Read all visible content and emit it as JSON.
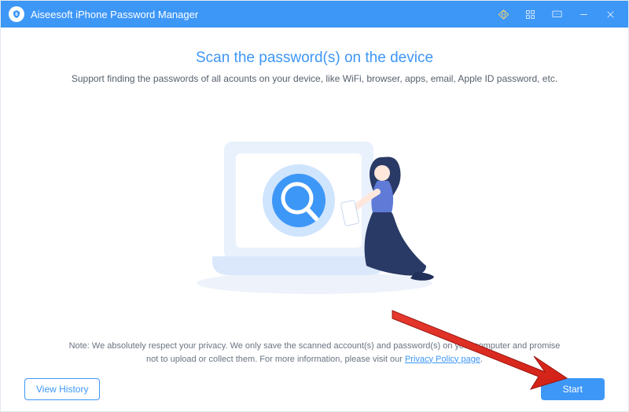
{
  "titlebar": {
    "app_title": "Aiseesoft iPhone Password Manager"
  },
  "main": {
    "heading": "Scan the password(s) on the device",
    "subheading": "Support finding the passwords of all acounts on your device, like  WiFi, browser, apps, email, Apple ID password, etc.",
    "note_prefix": "Note: We absolutely respect your privacy. We only save the scanned account(s) and password(s) on your computer and promise not to upload or collect them. For more information, please visit our ",
    "note_link": "Privacy Policy page",
    "note_suffix": "."
  },
  "footer": {
    "view_history": "View History",
    "start": "Start"
  }
}
